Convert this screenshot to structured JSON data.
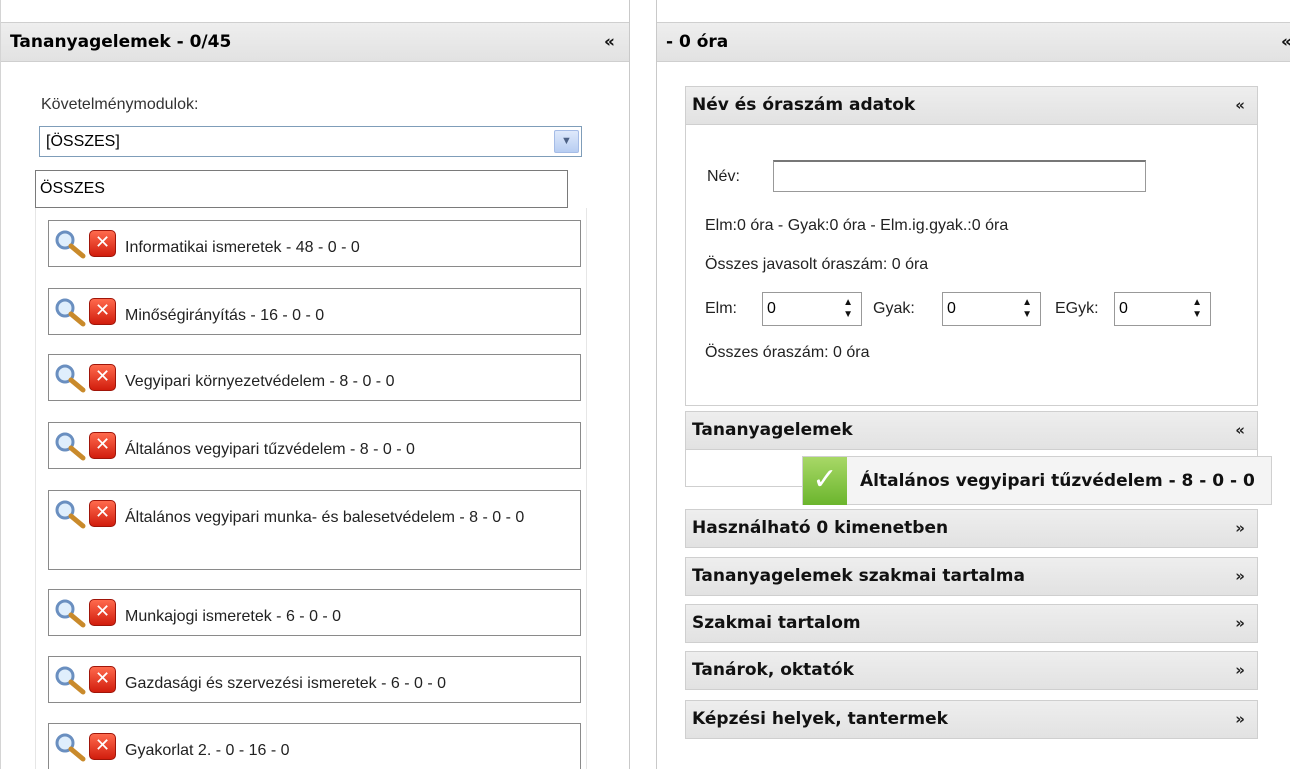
{
  "left_panel": {
    "title": "Tananyagelemek - 0/45",
    "collapse": "«",
    "module_label": "Követelménymodulok:",
    "module_select_value": "[ÖSSZES]",
    "filter_value": "ÖSSZES",
    "items": [
      {
        "label": "Informatikai ismeretek - 48 - 0 - 0"
      },
      {
        "label": "Minőségirányítás - 16 - 0 - 0"
      },
      {
        "label": "Vegyipari környezetvédelem - 8 - 0 - 0"
      },
      {
        "label": "Általános vegyipari tűzvédelem - 8 - 0 - 0"
      },
      {
        "label": "Általános vegyipari munka- és balesetvédelem - 8 - 0 - 0"
      },
      {
        "label": "Munkajogi ismeretek - 6 - 0 - 0"
      },
      {
        "label": "Gazdasági és szervezési ismeretek - 6 - 0 - 0"
      },
      {
        "label": "Gyakorlat 2. - 0 - 16 - 0"
      }
    ],
    "delete_glyph": "✕"
  },
  "right_panel": {
    "title": "- 0 óra",
    "collapse": "«",
    "sections": {
      "name_data": {
        "title": "Név és óraszám adatok",
        "chevron": "«",
        "name_label": "Név:",
        "name_value": "",
        "hours_line": "Elm:0 óra - Gyak:0 óra - Elm.ig.gyak.:0 óra",
        "suggested_line": "Összes javasolt óraszám: 0 óra",
        "elm_label": "Elm:",
        "elm_value": "0",
        "gyak_label": "Gyak:",
        "gyak_value": "0",
        "egyk_label": "EGyk:",
        "egyk_value": "0",
        "total_line": "Összes óraszám: 0 óra"
      },
      "lessons": {
        "title": "Tananyagelemek",
        "chevron": "«"
      },
      "collapsed": [
        {
          "title": "Használható 0 kimenetben",
          "chevron": "»"
        },
        {
          "title": "Tananyagelemek szakmai tartalma",
          "chevron": "»"
        },
        {
          "title": "Szakmai tartalom",
          "chevron": "»"
        },
        {
          "title": "Tanárok, oktatók",
          "chevron": "»"
        },
        {
          "title": "Képzési helyek, tantermek",
          "chevron": "»"
        }
      ]
    },
    "drag_tooltip": {
      "check": "✓",
      "text": "Általános vegyipari tűzvédelem - 8 - 0 - 0"
    }
  },
  "colors": {
    "header_bg": "#e6e6e6",
    "check_green": "#7cc13a",
    "delete_red": "#e0301a",
    "select_border": "#7f9db9"
  },
  "icons": {
    "item_view": "magnifier-icon",
    "item_delete": "delete-icon",
    "dropdown": "chevron-down-icon",
    "spinner": "spinner-arrows-icon",
    "drag_ok": "checkmark-icon"
  }
}
